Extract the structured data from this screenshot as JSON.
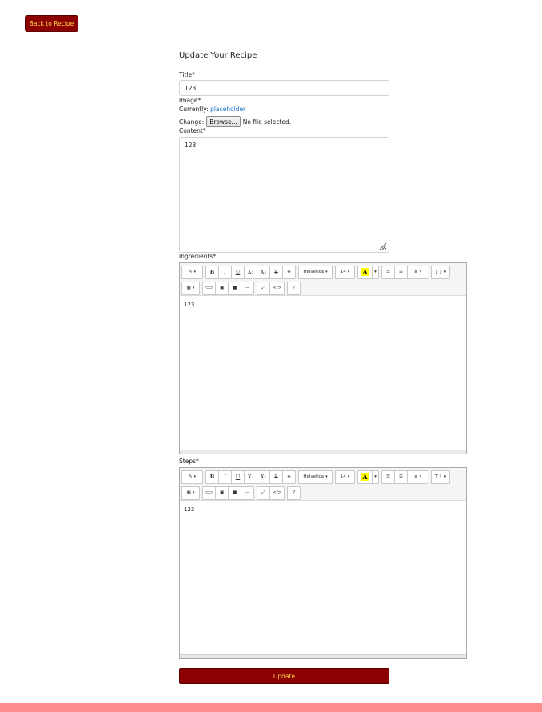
{
  "back_button": "Back to Recipe",
  "form": {
    "heading": "Update Your Recipe",
    "title_label": "Title*",
    "title_value": "123",
    "image_label": "Image*",
    "currently_label": "Currently:",
    "currently_link": "placeholder",
    "change_label": "Change:",
    "browse_label": "Browse...",
    "no_file_text": "No file selected.",
    "content_label": "Content*",
    "content_value": "123",
    "ingredients_label": "Ingredients*",
    "ingredients_value": "123",
    "steps_label": "Steps*",
    "steps_value": "123",
    "submit_label": "Update"
  },
  "toolbar": {
    "font_name": "Helvetica",
    "font_size": "14",
    "bold": "B",
    "italic": "I",
    "underline": "U",
    "superscript": "X",
    "subscript": "X",
    "strikethrough": "S",
    "color_letter": "A",
    "help": "?",
    "code": "</>",
    "style": "T",
    "icons": [
      "magic-icon",
      "bold-icon",
      "italic-icon",
      "underline-icon",
      "superscript-icon",
      "subscript-icon",
      "strikethrough-icon",
      "eraser-icon",
      "unordered-list-icon",
      "ordered-list-icon",
      "align-icon",
      "line-height-icon",
      "table-icon",
      "link-icon",
      "picture-icon",
      "video-icon",
      "horizontal-rule-icon",
      "fullscreen-icon",
      "code-view-icon",
      "help-icon"
    ]
  },
  "colors": {
    "primary": "#8b0000",
    "primary_text": "#ffd84a",
    "link": "#1a73c8",
    "footer": "#ff8c8c"
  }
}
